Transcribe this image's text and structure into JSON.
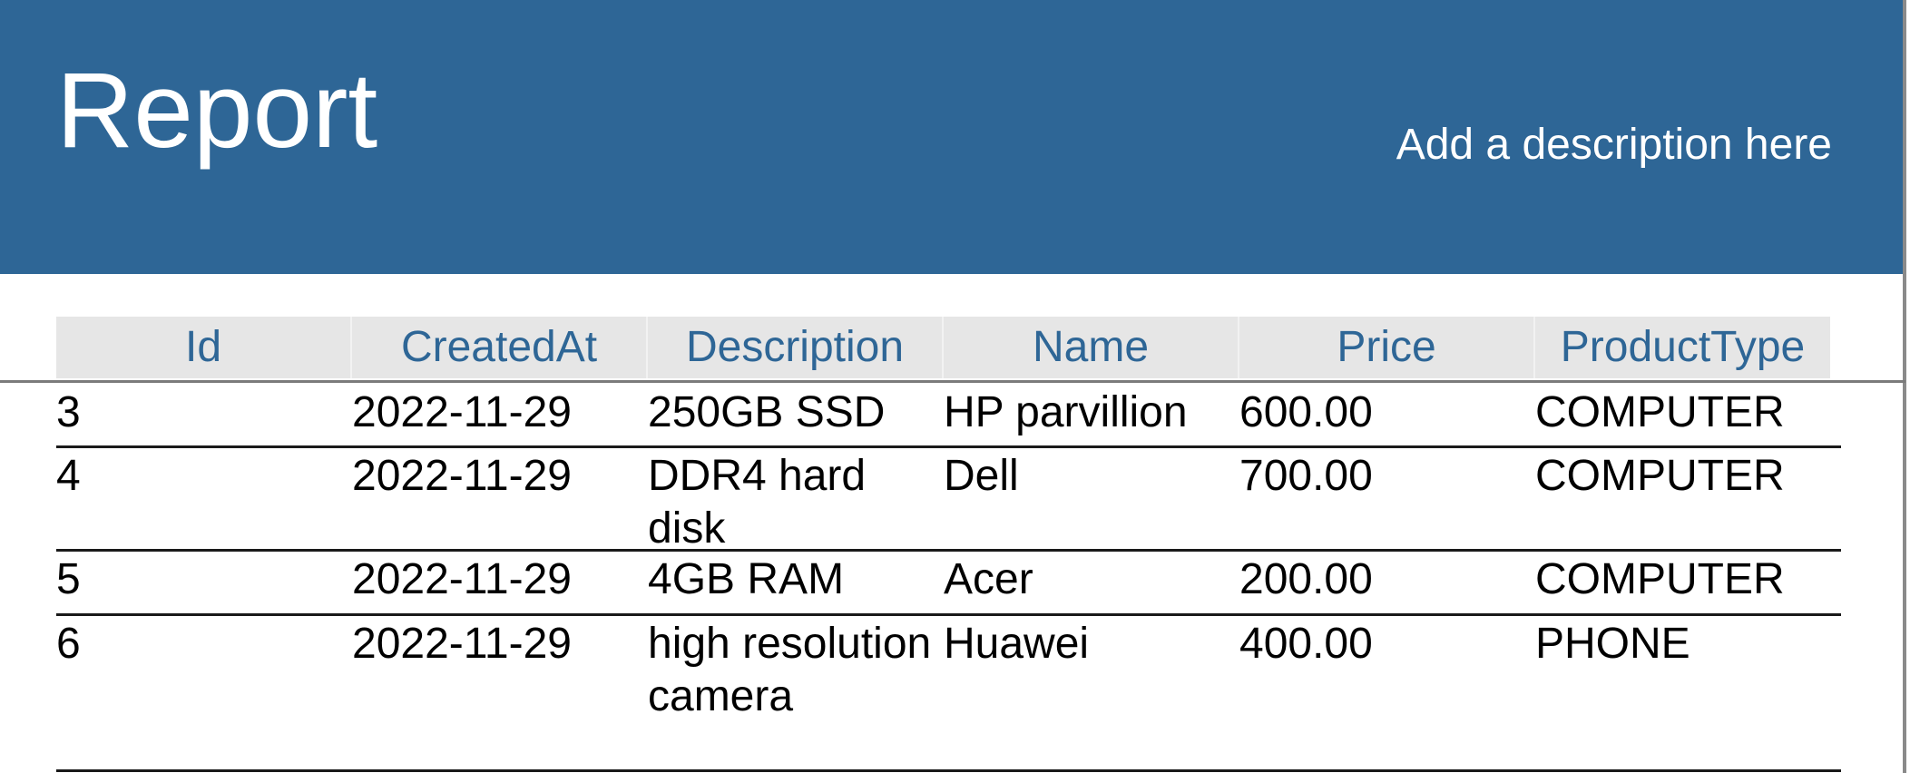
{
  "report": {
    "title": "Report",
    "description": "Add a description here"
  },
  "table": {
    "columns": [
      "Id",
      "CreatedAt",
      "Description",
      "Name",
      "Price",
      "ProductType"
    ],
    "rows": [
      [
        "3",
        "2022-11-29",
        "250GB SSD",
        "HP parvillion",
        "600.00",
        "COMPUTER"
      ],
      [
        "4",
        "2022-11-29",
        "DDR4 hard disk",
        "Dell",
        "700.00",
        "COMPUTER"
      ],
      [
        "5",
        "2022-11-29",
        "4GB RAM",
        "Acer",
        "200.00",
        "COMPUTER"
      ],
      [
        "6",
        "2022-11-29",
        "high resolution camera",
        "Huawei",
        "400.00",
        "PHONE"
      ]
    ]
  },
  "colors": {
    "banner": "#2e6696",
    "header_text": "#2e6696",
    "header_bg": "#e6e6e6"
  }
}
